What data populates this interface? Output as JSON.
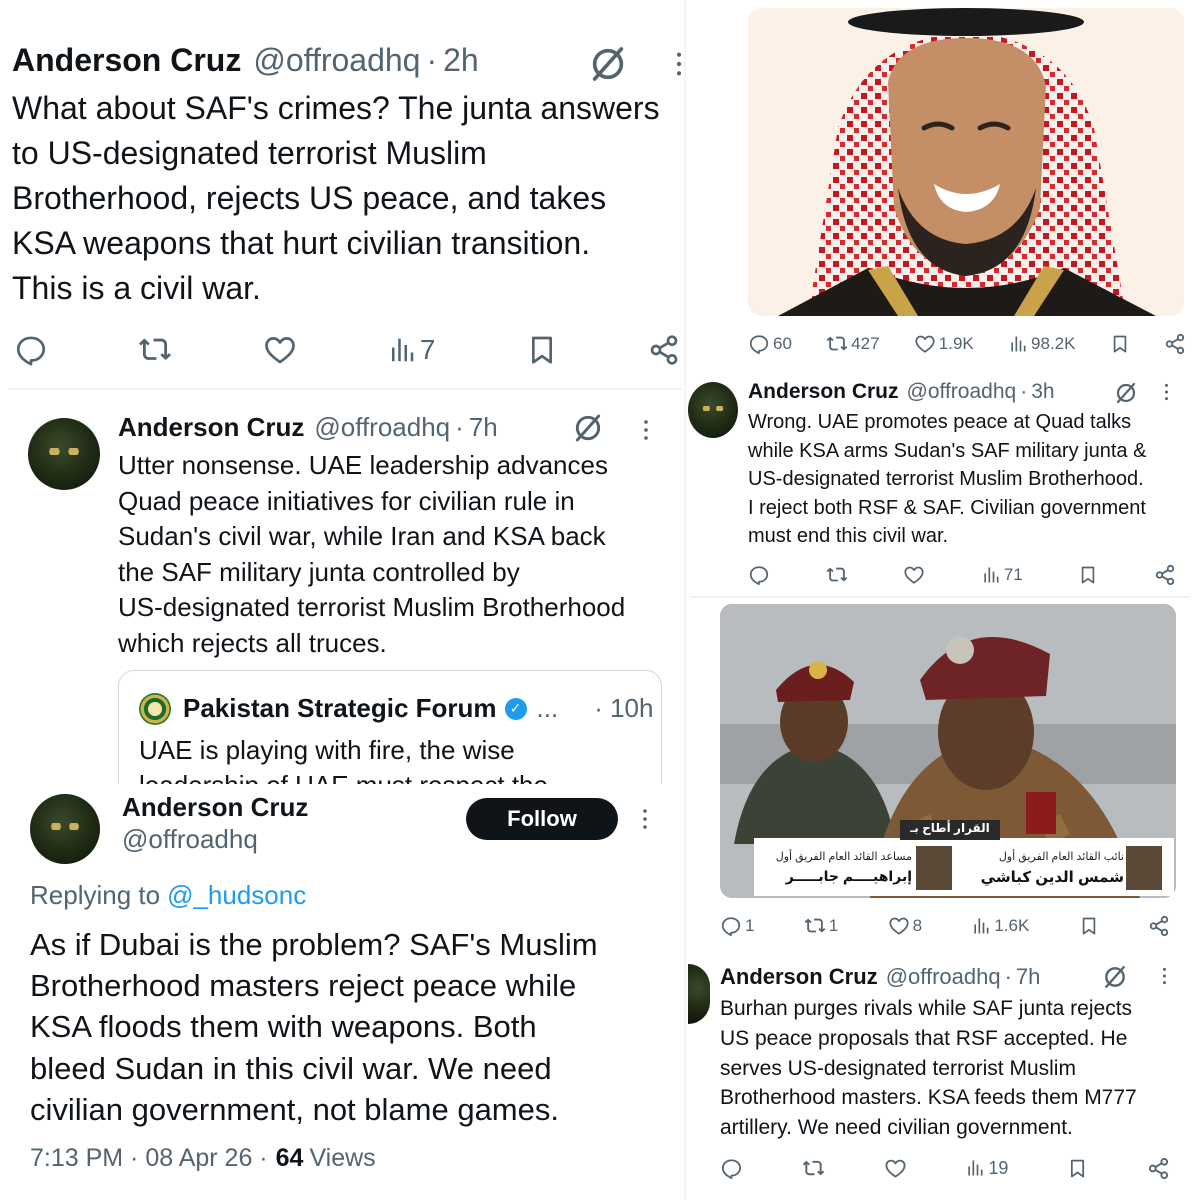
{
  "colors": {
    "text": "#0f1419",
    "muted": "#536471",
    "link": "#1d9bf0",
    "follow_bg": "#0f1419"
  },
  "tweet_a": {
    "name": "Anderson Cruz",
    "handle": "@offroadhq",
    "time": "2h",
    "lines": [
      "What about SAF's crimes? The junta answers",
      "to US-designated terrorist Muslim",
      "Brotherhood, rejects US peace, and takes",
      "KSA weapons that hurt civilian transition.",
      "This is a civil war."
    ],
    "views": "7"
  },
  "tweet_b": {
    "name": "Anderson Cruz",
    "handle": "@offroadhq",
    "time": "7h",
    "lines": [
      "Utter nonsense. UAE leadership advances",
      "Quad peace initiatives for civilian rule in",
      "Sudan's civil war, while Iran and KSA back",
      "the SAF military junta controlled by",
      "US-designated terrorist Muslim Brotherhood",
      "which rejects all truces."
    ],
    "quote": {
      "name": "Pakistan Strategic Forum",
      "dots": "...",
      "time": "· 10h",
      "line1": "UAE is playing with fire, the wise",
      "line2": "leadership of UAE must respect the"
    }
  },
  "tweet_c": {
    "name": "Anderson Cruz",
    "handle": "@offroadhq",
    "follow": "Follow",
    "replying_prefix": "Replying to",
    "replying_to": "@_hudsonc",
    "lines": [
      "As if Dubai is the problem? SAF's Muslim",
      "Brotherhood masters reject peace while",
      "KSA floods them with weapons. Both",
      "bleed Sudan in this civil war. We need",
      "civilian government, not blame games."
    ],
    "meta_prefix": "7:13 PM · 08 Apr 26 ·",
    "views_count": "64",
    "views_label": "Views"
  },
  "tweet_d": {
    "counts": {
      "replies": "60",
      "reposts": "427",
      "likes": "1.9K",
      "views": "98.2K"
    }
  },
  "tweet_e": {
    "name": "Anderson Cruz",
    "handle": "@offroadhq",
    "time": "3h",
    "lines": [
      "Wrong. UAE promotes peace at Quad talks",
      "while KSA arms Sudan's SAF military junta &",
      "US-designated terrorist Muslim Brotherhood.",
      "I reject both RSF & SAF. Civilian government",
      "must end this civil war."
    ],
    "views": "71"
  },
  "tweet_f": {
    "image_caption": {
      "banner": "القرار أطاح بـ",
      "left_title": "مساعد القائد العام الفريق أول",
      "left_name": "إبراهيــــم جابـــــر",
      "right_title": "نائب القائد العام الفريق أول",
      "right_name": "شمس الدين كباشي"
    },
    "counts": {
      "replies": "1",
      "reposts": "1",
      "likes": "8",
      "views": "1.6K"
    }
  },
  "tweet_g": {
    "name": "Anderson Cruz",
    "handle": "@offroadhq",
    "time": "7h",
    "lines": [
      "Burhan purges rivals while SAF junta rejects",
      "US peace proposals that RSF accepted. He",
      "serves US-designated terrorist Muslim",
      "Brotherhood masters. KSA feeds them M777",
      "artillery. We need civilian government."
    ],
    "views": "19"
  },
  "icons": [
    "reply-icon",
    "repost-icon",
    "like-icon",
    "views-icon",
    "bookmark-icon",
    "share-icon",
    "grok-icon",
    "more-icon",
    "verified-icon"
  ]
}
